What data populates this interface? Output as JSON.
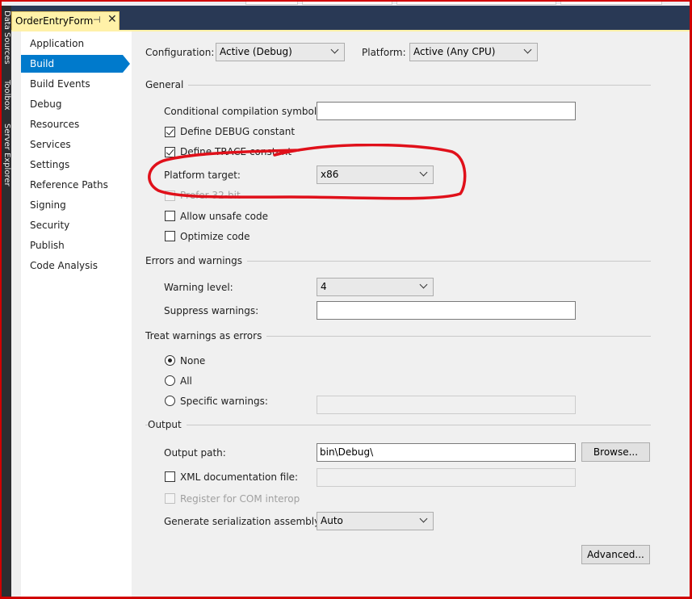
{
  "document_tab": {
    "title": "OrderEntryForm",
    "pin_icon": "pin-icon",
    "close_icon": "close-icon"
  },
  "side_tools": [
    "Data Sources",
    "Toolbox",
    "Server Explorer"
  ],
  "nav": {
    "items": [
      "Application",
      "Build",
      "Build Events",
      "Debug",
      "Resources",
      "Services",
      "Settings",
      "Reference Paths",
      "Signing",
      "Security",
      "Publish",
      "Code Analysis"
    ],
    "selected": "Build"
  },
  "config": {
    "configuration_label": "Configuration:",
    "configuration_value": "Active (Debug)",
    "platform_label": "Platform:",
    "platform_value": "Active (Any CPU)"
  },
  "general": {
    "title": "General",
    "conditional_label": "Conditional compilation symbols:",
    "conditional_value": "",
    "define_debug": {
      "label": "Define DEBUG constant",
      "checked": true
    },
    "define_trace": {
      "label": "Define TRACE constant",
      "checked": true
    },
    "platform_target_label": "Platform target:",
    "platform_target_value": "x86",
    "prefer32": {
      "label": "Prefer 32-bit",
      "checked": false,
      "enabled": false
    },
    "allow_unsafe": {
      "label": "Allow unsafe code",
      "checked": false
    },
    "optimize": {
      "label": "Optimize code",
      "checked": false
    }
  },
  "errors": {
    "title": "Errors and warnings",
    "warning_level_label": "Warning level:",
    "warning_level_value": "4",
    "suppress_label": "Suppress warnings:",
    "suppress_value": ""
  },
  "treat": {
    "title": "Treat warnings as errors",
    "none_label": "None",
    "all_label": "All",
    "specific_label": "Specific warnings:",
    "selected": "None",
    "specific_value": ""
  },
  "output": {
    "title": "Output",
    "output_path_label": "Output path:",
    "output_path_value": "bin\\Debug\\",
    "browse_label": "Browse...",
    "xml_doc": {
      "label": "XML documentation file:",
      "checked": false
    },
    "xml_doc_value": "",
    "com_interop": {
      "label": "Register for COM interop",
      "checked": false,
      "enabled": false
    },
    "serialization_label": "Generate serialization assembly:",
    "serialization_value": "Auto",
    "advanced_label": "Advanced..."
  },
  "colors": {
    "accent": "#007acc",
    "tab_active": "#fff1a8",
    "tab_row": "#293955",
    "annotation": "#e0101a"
  }
}
